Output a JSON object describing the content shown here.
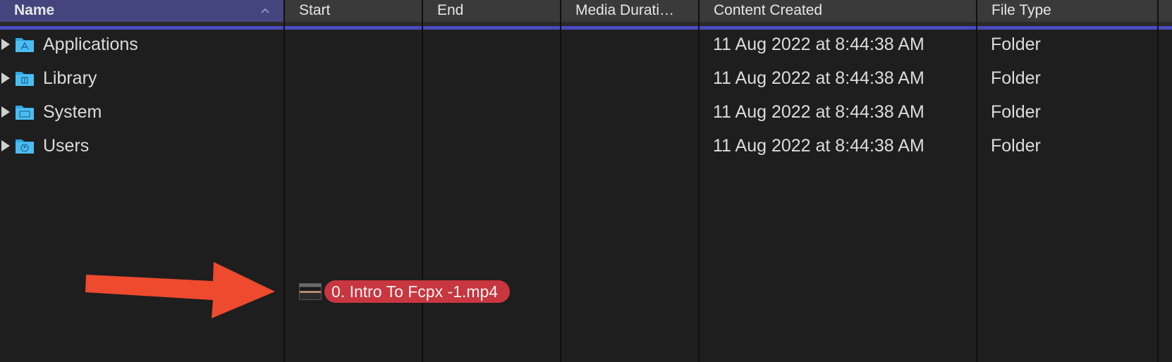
{
  "columns": {
    "name": "Name",
    "start": "Start",
    "end": "End",
    "media_duration": "Media Durati…",
    "content_created": "Content Created",
    "file_type": "File Type"
  },
  "rows": [
    {
      "name": "Applications",
      "content_created": "11 Aug 2022 at 8:44:38 AM",
      "file_type": "Folder",
      "icon": "applications-folder-icon"
    },
    {
      "name": "Library",
      "content_created": "11 Aug 2022 at 8:44:38 AM",
      "file_type": "Folder",
      "icon": "library-folder-icon"
    },
    {
      "name": "System",
      "content_created": "11 Aug 2022 at 8:44:38 AM",
      "file_type": "Folder",
      "icon": "system-folder-icon"
    },
    {
      "name": "Users",
      "content_created": "11 Aug 2022 at 8:44:38 AM",
      "file_type": "Folder",
      "icon": "users-folder-icon"
    }
  ],
  "drag_item": {
    "label": "0. Intro To Fcpx -1.mp4"
  },
  "colors": {
    "sorted_header": "#44447f",
    "selection_line": "#4b4bbf",
    "folder_blue": "#2fa8e6",
    "drag_label": "#c8363f",
    "annotation_arrow": "#ee4a2e"
  }
}
